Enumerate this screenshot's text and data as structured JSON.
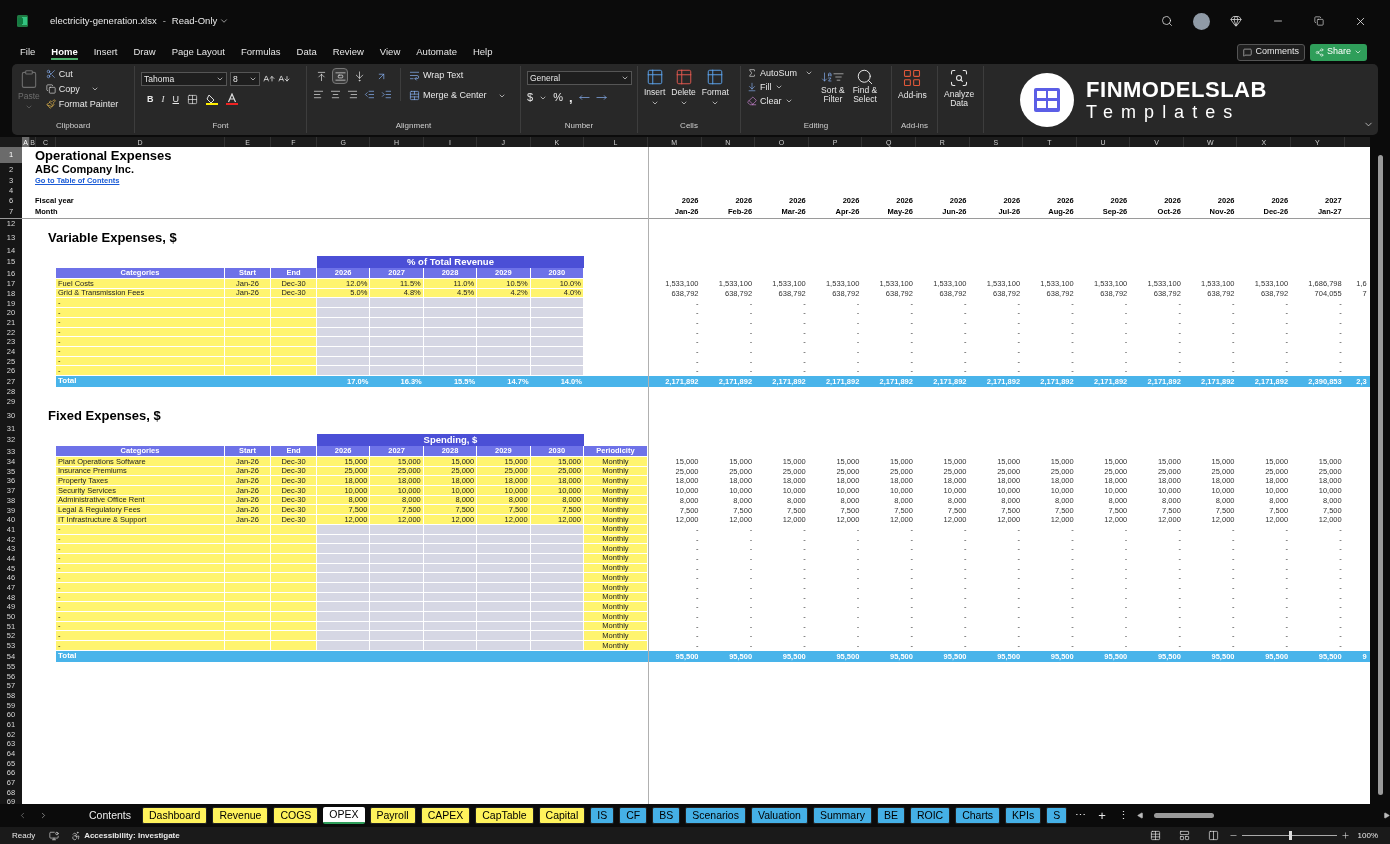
{
  "window": {
    "title": "electricity-generation.xlsx",
    "separator": "-",
    "mode": "Read-Only"
  },
  "menu": [
    {
      "label": "File",
      "selected": false
    },
    {
      "label": "Home",
      "selected": true
    },
    {
      "label": "Insert",
      "selected": false
    },
    {
      "label": "Draw",
      "selected": false
    },
    {
      "label": "Page Layout",
      "selected": false
    },
    {
      "label": "Formulas",
      "selected": false
    },
    {
      "label": "Data",
      "selected": false
    },
    {
      "label": "Review",
      "selected": false
    },
    {
      "label": "View",
      "selected": false
    },
    {
      "label": "Automate",
      "selected": false
    },
    {
      "label": "Help",
      "selected": false
    }
  ],
  "comments_button": "Comments",
  "share_button": "Share",
  "ribbon": {
    "clipboard": {
      "label": "Clipboard",
      "paste": "Paste",
      "paste_disabled": true,
      "cut": "Cut",
      "copy": "Copy",
      "format_painter": "Format Painter"
    },
    "font": {
      "label": "Font",
      "family": "Tahoma",
      "size": "8",
      "bold": "B",
      "italic": "I",
      "underline": "U"
    },
    "alignment": {
      "label": "Alignment",
      "vertical": [
        {
          "selected": false
        },
        {
          "selected": true
        },
        {
          "selected": false
        }
      ],
      "wrap": "Wrap Text",
      "merge": "Merge & Center"
    },
    "number": {
      "label": "Number",
      "format": "General",
      "currency": "$",
      "percent": "%",
      "comma": ","
    },
    "cells": {
      "label": "Cells",
      "insert": "Insert",
      "delete": "Delete",
      "format": "Format"
    },
    "editing": {
      "label": "Editing",
      "autosum": "AutoSum",
      "fill": "Fill",
      "clear": "Clear",
      "sort": [
        "Sort &",
        "Filter"
      ],
      "find": [
        "Find &",
        "Select"
      ]
    },
    "addins": {
      "label": "Add-ins",
      "button": "Add-ins"
    },
    "analyze": {
      "button": [
        "Analyze",
        "Data"
      ]
    },
    "logo": {
      "name": "FINMODELSLAB",
      "tagline": "Templates"
    }
  },
  "column_headers": [
    {
      "label": "A",
      "selected": true
    },
    {
      "label": "B",
      "selected": false
    },
    {
      "label": "C",
      "selected": false
    },
    {
      "label": "D",
      "selected": false
    },
    {
      "label": "E",
      "selected": false
    },
    {
      "label": "F",
      "selected": false
    },
    {
      "label": "G",
      "selected": false
    },
    {
      "label": "H",
      "selected": false
    },
    {
      "label": "I",
      "selected": false
    },
    {
      "label": "J",
      "selected": false
    },
    {
      "label": "K",
      "selected": false
    },
    {
      "label": "L",
      "selected": false
    },
    {
      "label": "M",
      "selected": false
    },
    {
      "label": "N",
      "selected": false
    },
    {
      "label": "O",
      "selected": false
    },
    {
      "label": "P",
      "selected": false
    },
    {
      "label": "Q",
      "selected": false
    },
    {
      "label": "R",
      "selected": false
    },
    {
      "label": "S",
      "selected": false
    },
    {
      "label": "T",
      "selected": false
    },
    {
      "label": "U",
      "selected": false
    },
    {
      "label": "V",
      "selected": false
    },
    {
      "label": "W",
      "selected": false
    },
    {
      "label": "X",
      "selected": false
    },
    {
      "label": "Y",
      "selected": false
    }
  ],
  "frozen_rows": [
    {
      "number": "1",
      "selected": true,
      "kind": "title",
      "text": "Operational Expenses"
    },
    {
      "number": "2",
      "selected": false,
      "kind": "subtitle",
      "text": "ABC Company Inc."
    },
    {
      "number": "3",
      "selected": false,
      "kind": "link",
      "text": "Go to Table of Contents"
    },
    {
      "number": "4",
      "selected": false,
      "kind": "blank"
    },
    {
      "number": "6",
      "selected": false,
      "kind": "header_line",
      "label": "Fiscal year",
      "monthly": [
        "2026",
        "2026",
        "2026",
        "2026",
        "2026",
        "2026",
        "2026",
        "2026",
        "2026",
        "2026",
        "2026",
        "2026",
        "2027"
      ]
    },
    {
      "number": "7",
      "selected": false,
      "kind": "header_line",
      "label": "Month",
      "monthly": [
        "Jan-26",
        "Feb-26",
        "Mar-26",
        "Apr-26",
        "May-26",
        "Jun-26",
        "Jul-26",
        "Aug-26",
        "Sep-26",
        "Oct-26",
        "Nov-26",
        "Dec-26",
        "Jan-27"
      ]
    }
  ],
  "rows": [
    {
      "number": "12",
      "selected": false,
      "kind": "blank"
    },
    {
      "number": "13",
      "selected": false,
      "kind": "section",
      "text": "Variable Expenses, $"
    },
    {
      "number": "14",
      "selected": false,
      "kind": "blank"
    },
    {
      "number": "15",
      "selected": false,
      "kind": "band",
      "text": "% of Total Revenue"
    },
    {
      "number": "16",
      "selected": false,
      "kind": "table_header",
      "cells": [
        "Categories",
        "Start",
        "End",
        "2026",
        "2027",
        "2028",
        "2029",
        "2030"
      ]
    },
    {
      "number": "17",
      "selected": false,
      "kind": "data",
      "category": "Fuel Costs",
      "start": "Jan-26",
      "end": "Dec-30",
      "values": [
        "12.0%",
        "11.5%",
        "11.0%",
        "10.5%",
        "10.0%"
      ],
      "monthly": [
        "1,533,100",
        "1,533,100",
        "1,533,100",
        "1,533,100",
        "1,533,100",
        "1,533,100",
        "1,533,100",
        "1,533,100",
        "1,533,100",
        "1,533,100",
        "1,533,100",
        "1,533,100",
        "1,686,798",
        "1,6"
      ]
    },
    {
      "number": "18",
      "selected": false,
      "kind": "data",
      "category": "Grid & Transmission Fees",
      "start": "Jan-26",
      "end": "Dec-30",
      "values": [
        "5.0%",
        "4.8%",
        "4.5%",
        "4.2%",
        "4.0%"
      ],
      "monthly": [
        "638,792",
        "638,792",
        "638,792",
        "638,792",
        "638,792",
        "638,792",
        "638,792",
        "638,792",
        "638,792",
        "638,792",
        "638,792",
        "638,792",
        "704,055",
        "7"
      ]
    },
    {
      "number": "19",
      "selected": false,
      "kind": "data",
      "category": "-",
      "monthly": [
        "-",
        "-",
        "-",
        "-",
        "-",
        "-",
        "-",
        "-",
        "-",
        "-",
        "-",
        "-",
        "-"
      ]
    },
    {
      "number": "20",
      "selected": false,
      "kind": "data",
      "category": "-",
      "monthly": [
        "-",
        "-",
        "-",
        "-",
        "-",
        "-",
        "-",
        "-",
        "-",
        "-",
        "-",
        "-",
        "-"
      ]
    },
    {
      "number": "21",
      "selected": false,
      "kind": "data",
      "category": "-",
      "monthly": [
        "-",
        "-",
        "-",
        "-",
        "-",
        "-",
        "-",
        "-",
        "-",
        "-",
        "-",
        "-",
        "-"
      ]
    },
    {
      "number": "22",
      "selected": false,
      "kind": "data",
      "category": "-",
      "monthly": [
        "-",
        "-",
        "-",
        "-",
        "-",
        "-",
        "-",
        "-",
        "-",
        "-",
        "-",
        "-",
        "-"
      ]
    },
    {
      "number": "23",
      "selected": false,
      "kind": "data",
      "category": "-",
      "monthly": [
        "-",
        "-",
        "-",
        "-",
        "-",
        "-",
        "-",
        "-",
        "-",
        "-",
        "-",
        "-",
        "-"
      ]
    },
    {
      "number": "24",
      "selected": false,
      "kind": "data",
      "category": "-",
      "monthly": [
        "-",
        "-",
        "-",
        "-",
        "-",
        "-",
        "-",
        "-",
        "-",
        "-",
        "-",
        "-",
        "-"
      ]
    },
    {
      "number": "25",
      "selected": false,
      "kind": "data",
      "category": "-",
      "monthly": [
        "-",
        "-",
        "-",
        "-",
        "-",
        "-",
        "-",
        "-",
        "-",
        "-",
        "-",
        "-",
        "-"
      ]
    },
    {
      "number": "26",
      "selected": false,
      "kind": "data",
      "category": "-",
      "monthly": [
        "-",
        "-",
        "-",
        "-",
        "-",
        "-",
        "-",
        "-",
        "-",
        "-",
        "-",
        "-",
        "-"
      ]
    },
    {
      "number": "27",
      "selected": false,
      "kind": "total",
      "label": "Total",
      "values": [
        "17.0%",
        "16.3%",
        "15.5%",
        "14.7%",
        "14.0%"
      ],
      "monthly": [
        "2,171,892",
        "2,171,892",
        "2,171,892",
        "2,171,892",
        "2,171,892",
        "2,171,892",
        "2,171,892",
        "2,171,892",
        "2,171,892",
        "2,171,892",
        "2,171,892",
        "2,171,892",
        "2,390,853",
        "2,3"
      ]
    },
    {
      "number": "28",
      "selected": false,
      "kind": "blank"
    },
    {
      "number": "29",
      "selected": false,
      "kind": "blank"
    },
    {
      "number": "30",
      "selected": false,
      "kind": "section",
      "text": "Fixed Expenses, $"
    },
    {
      "number": "31",
      "selected": false,
      "kind": "blank"
    },
    {
      "number": "32",
      "selected": false,
      "kind": "band",
      "text": "Spending, $"
    },
    {
      "number": "33",
      "selected": false,
      "kind": "table_header",
      "cells": [
        "Categories",
        "Start",
        "End",
        "2026",
        "2027",
        "2028",
        "2029",
        "2030",
        "Periodicity"
      ]
    },
    {
      "number": "34",
      "selected": false,
      "kind": "data",
      "category": "Plant Operations Software",
      "start": "Jan-26",
      "end": "Dec-30",
      "values": [
        "15,000",
        "15,000",
        "15,000",
        "15,000",
        "15,000"
      ],
      "periodicity": "Monthly",
      "monthly": [
        "15,000",
        "15,000",
        "15,000",
        "15,000",
        "15,000",
        "15,000",
        "15,000",
        "15,000",
        "15,000",
        "15,000",
        "15,000",
        "15,000",
        "15,000"
      ]
    },
    {
      "number": "35",
      "selected": false,
      "kind": "data",
      "category": "Insurance Premiums",
      "start": "Jan-26",
      "end": "Dec-30",
      "values": [
        "25,000",
        "25,000",
        "25,000",
        "25,000",
        "25,000"
      ],
      "periodicity": "Monthly",
      "monthly": [
        "25,000",
        "25,000",
        "25,000",
        "25,000",
        "25,000",
        "25,000",
        "25,000",
        "25,000",
        "25,000",
        "25,000",
        "25,000",
        "25,000",
        "25,000"
      ]
    },
    {
      "number": "36",
      "selected": false,
      "kind": "data",
      "category": "Property Taxes",
      "start": "Jan-26",
      "end": "Dec-30",
      "values": [
        "18,000",
        "18,000",
        "18,000",
        "18,000",
        "18,000"
      ],
      "periodicity": "Monthly",
      "monthly": [
        "18,000",
        "18,000",
        "18,000",
        "18,000",
        "18,000",
        "18,000",
        "18,000",
        "18,000",
        "18,000",
        "18,000",
        "18,000",
        "18,000",
        "18,000"
      ]
    },
    {
      "number": "37",
      "selected": false,
      "kind": "data",
      "category": "Security Services",
      "start": "Jan-26",
      "end": "Dec-30",
      "values": [
        "10,000",
        "10,000",
        "10,000",
        "10,000",
        "10,000"
      ],
      "periodicity": "Monthly",
      "monthly": [
        "10,000",
        "10,000",
        "10,000",
        "10,000",
        "10,000",
        "10,000",
        "10,000",
        "10,000",
        "10,000",
        "10,000",
        "10,000",
        "10,000",
        "10,000"
      ]
    },
    {
      "number": "38",
      "selected": false,
      "kind": "data",
      "category": "Administrative Office Rent",
      "start": "Jan-26",
      "end": "Dec-30",
      "values": [
        "8,000",
        "8,000",
        "8,000",
        "8,000",
        "8,000"
      ],
      "periodicity": "Monthly",
      "monthly": [
        "8,000",
        "8,000",
        "8,000",
        "8,000",
        "8,000",
        "8,000",
        "8,000",
        "8,000",
        "8,000",
        "8,000",
        "8,000",
        "8,000",
        "8,000"
      ]
    },
    {
      "number": "39",
      "selected": false,
      "kind": "data",
      "category": "Legal & Regulatory Fees",
      "start": "Jan-26",
      "end": "Dec-30",
      "values": [
        "7,500",
        "7,500",
        "7,500",
        "7,500",
        "7,500"
      ],
      "periodicity": "Monthly",
      "monthly": [
        "7,500",
        "7,500",
        "7,500",
        "7,500",
        "7,500",
        "7,500",
        "7,500",
        "7,500",
        "7,500",
        "7,500",
        "7,500",
        "7,500",
        "7,500"
      ]
    },
    {
      "number": "40",
      "selected": false,
      "kind": "data",
      "category": "IT Infrastructure & Support",
      "start": "Jan-26",
      "end": "Dec-30",
      "values": [
        "12,000",
        "12,000",
        "12,000",
        "12,000",
        "12,000"
      ],
      "periodicity": "Monthly",
      "monthly": [
        "12,000",
        "12,000",
        "12,000",
        "12,000",
        "12,000",
        "12,000",
        "12,000",
        "12,000",
        "12,000",
        "12,000",
        "12,000",
        "12,000",
        "12,000"
      ]
    },
    {
      "number": "41",
      "selected": false,
      "kind": "data",
      "category": "-",
      "periodicity": "Monthly",
      "monthly": [
        "-",
        "-",
        "-",
        "-",
        "-",
        "-",
        "-",
        "-",
        "-",
        "-",
        "-",
        "-",
        "-"
      ]
    },
    {
      "number": "42",
      "selected": false,
      "kind": "data",
      "category": "-",
      "periodicity": "Monthly",
      "monthly": [
        "-",
        "-",
        "-",
        "-",
        "-",
        "-",
        "-",
        "-",
        "-",
        "-",
        "-",
        "-",
        "-"
      ]
    },
    {
      "number": "43",
      "selected": false,
      "kind": "data",
      "category": "-",
      "periodicity": "Monthly",
      "monthly": [
        "-",
        "-",
        "-",
        "-",
        "-",
        "-",
        "-",
        "-",
        "-",
        "-",
        "-",
        "-",
        "-"
      ]
    },
    {
      "number": "44",
      "selected": false,
      "kind": "data",
      "category": "-",
      "periodicity": "Monthly",
      "monthly": [
        "-",
        "-",
        "-",
        "-",
        "-",
        "-",
        "-",
        "-",
        "-",
        "-",
        "-",
        "-",
        "-"
      ]
    },
    {
      "number": "45",
      "selected": false,
      "kind": "data",
      "category": "-",
      "periodicity": "Monthly",
      "monthly": [
        "-",
        "-",
        "-",
        "-",
        "-",
        "-",
        "-",
        "-",
        "-",
        "-",
        "-",
        "-",
        "-"
      ]
    },
    {
      "number": "46",
      "selected": false,
      "kind": "data",
      "category": "-",
      "periodicity": "Monthly",
      "monthly": [
        "-",
        "-",
        "-",
        "-",
        "-",
        "-",
        "-",
        "-",
        "-",
        "-",
        "-",
        "-",
        "-"
      ]
    },
    {
      "number": "47",
      "selected": false,
      "kind": "data",
      "category": "-",
      "periodicity": "Monthly",
      "monthly": [
        "-",
        "-",
        "-",
        "-",
        "-",
        "-",
        "-",
        "-",
        "-",
        "-",
        "-",
        "-",
        "-"
      ]
    },
    {
      "number": "48",
      "selected": false,
      "kind": "data",
      "category": "-",
      "periodicity": "Monthly",
      "monthly": [
        "-",
        "-",
        "-",
        "-",
        "-",
        "-",
        "-",
        "-",
        "-",
        "-",
        "-",
        "-",
        "-"
      ]
    },
    {
      "number": "49",
      "selected": false,
      "kind": "data",
      "category": "-",
      "periodicity": "Monthly",
      "monthly": [
        "-",
        "-",
        "-",
        "-",
        "-",
        "-",
        "-",
        "-",
        "-",
        "-",
        "-",
        "-",
        "-"
      ]
    },
    {
      "number": "50",
      "selected": false,
      "kind": "data",
      "category": "-",
      "periodicity": "Monthly",
      "monthly": [
        "-",
        "-",
        "-",
        "-",
        "-",
        "-",
        "-",
        "-",
        "-",
        "-",
        "-",
        "-",
        "-"
      ]
    },
    {
      "number": "51",
      "selected": false,
      "kind": "data",
      "category": "-",
      "periodicity": "Monthly",
      "monthly": [
        "-",
        "-",
        "-",
        "-",
        "-",
        "-",
        "-",
        "-",
        "-",
        "-",
        "-",
        "-",
        "-"
      ]
    },
    {
      "number": "52",
      "selected": false,
      "kind": "data",
      "category": "-",
      "periodicity": "Monthly",
      "monthly": [
        "-",
        "-",
        "-",
        "-",
        "-",
        "-",
        "-",
        "-",
        "-",
        "-",
        "-",
        "-",
        "-"
      ]
    },
    {
      "number": "53",
      "selected": false,
      "kind": "data",
      "category": "-",
      "periodicity": "Monthly",
      "monthly": [
        "-",
        "-",
        "-",
        "-",
        "-",
        "-",
        "-",
        "-",
        "-",
        "-",
        "-",
        "-",
        "-"
      ]
    },
    {
      "number": "54",
      "selected": false,
      "kind": "total",
      "label": "Total",
      "monthly": [
        "95,500",
        "95,500",
        "95,500",
        "95,500",
        "95,500",
        "95,500",
        "95,500",
        "95,500",
        "95,500",
        "95,500",
        "95,500",
        "95,500",
        "95,500",
        "9"
      ]
    },
    {
      "number": "55",
      "selected": false,
      "kind": "blank"
    },
    {
      "number": "56",
      "selected": false,
      "kind": "blank"
    },
    {
      "number": "57",
      "selected": false,
      "kind": "blank"
    },
    {
      "number": "58",
      "selected": false,
      "kind": "blank"
    },
    {
      "number": "59",
      "selected": false,
      "kind": "blank"
    },
    {
      "number": "60",
      "selected": false,
      "kind": "blank"
    },
    {
      "number": "61",
      "selected": false,
      "kind": "blank"
    },
    {
      "number": "62",
      "selected": false,
      "kind": "blank"
    },
    {
      "number": "63",
      "selected": false,
      "kind": "blank"
    },
    {
      "number": "64",
      "selected": false,
      "kind": "blank"
    },
    {
      "number": "65",
      "selected": false,
      "kind": "blank"
    },
    {
      "number": "66",
      "selected": false,
      "kind": "blank"
    },
    {
      "number": "67",
      "selected": false,
      "kind": "blank"
    },
    {
      "number": "68",
      "selected": false,
      "kind": "blank"
    },
    {
      "number": "69",
      "selected": false,
      "kind": "blank"
    }
  ],
  "sheet_tabs": [
    {
      "label": "Contents",
      "selected": false
    },
    {
      "label": "Dashboard",
      "selected": false,
      "color": "#fff35c"
    },
    {
      "label": "Revenue",
      "selected": false,
      "color": "#fff35c"
    },
    {
      "label": "COGS",
      "selected": false,
      "color": "#fff35c"
    },
    {
      "label": "OPEX",
      "selected": true
    },
    {
      "label": "Payroll",
      "selected": false,
      "color": "#fff35c"
    },
    {
      "label": "CAPEX",
      "selected": false,
      "color": "#fff35c"
    },
    {
      "label": "CapTable",
      "selected": false,
      "color": "#fff35c"
    },
    {
      "label": "Capital",
      "selected": false,
      "color": "#fff35c"
    },
    {
      "label": "IS",
      "selected": false,
      "color": "#45b0e6"
    },
    {
      "label": "CF",
      "selected": false,
      "color": "#45b0e6"
    },
    {
      "label": "BS",
      "selected": false,
      "color": "#45b0e6"
    },
    {
      "label": "Scenarios",
      "selected": false,
      "color": "#45b0e6"
    },
    {
      "label": "Valuation",
      "selected": false,
      "color": "#45b0e6"
    },
    {
      "label": "Summary",
      "selected": false,
      "color": "#45b0e6"
    },
    {
      "label": "BE",
      "selected": false,
      "color": "#45b0e6"
    },
    {
      "label": "ROIC",
      "selected": false,
      "color": "#45b0e6"
    },
    {
      "label": "Charts",
      "selected": false,
      "color": "#45b0e6"
    },
    {
      "label": "KPIs",
      "selected": false,
      "color": "#45b0e6"
    },
    {
      "label": "S",
      "selected": false,
      "color": "#45b0e6"
    }
  ],
  "tab_controls": {
    "more": "⋯",
    "add": "+",
    "options": "⋮"
  },
  "status_bar": {
    "ready": "Ready",
    "accessibility": "Accessibility: Investigate",
    "zoom": {
      "level": 0.5,
      "reading": "100%"
    }
  }
}
